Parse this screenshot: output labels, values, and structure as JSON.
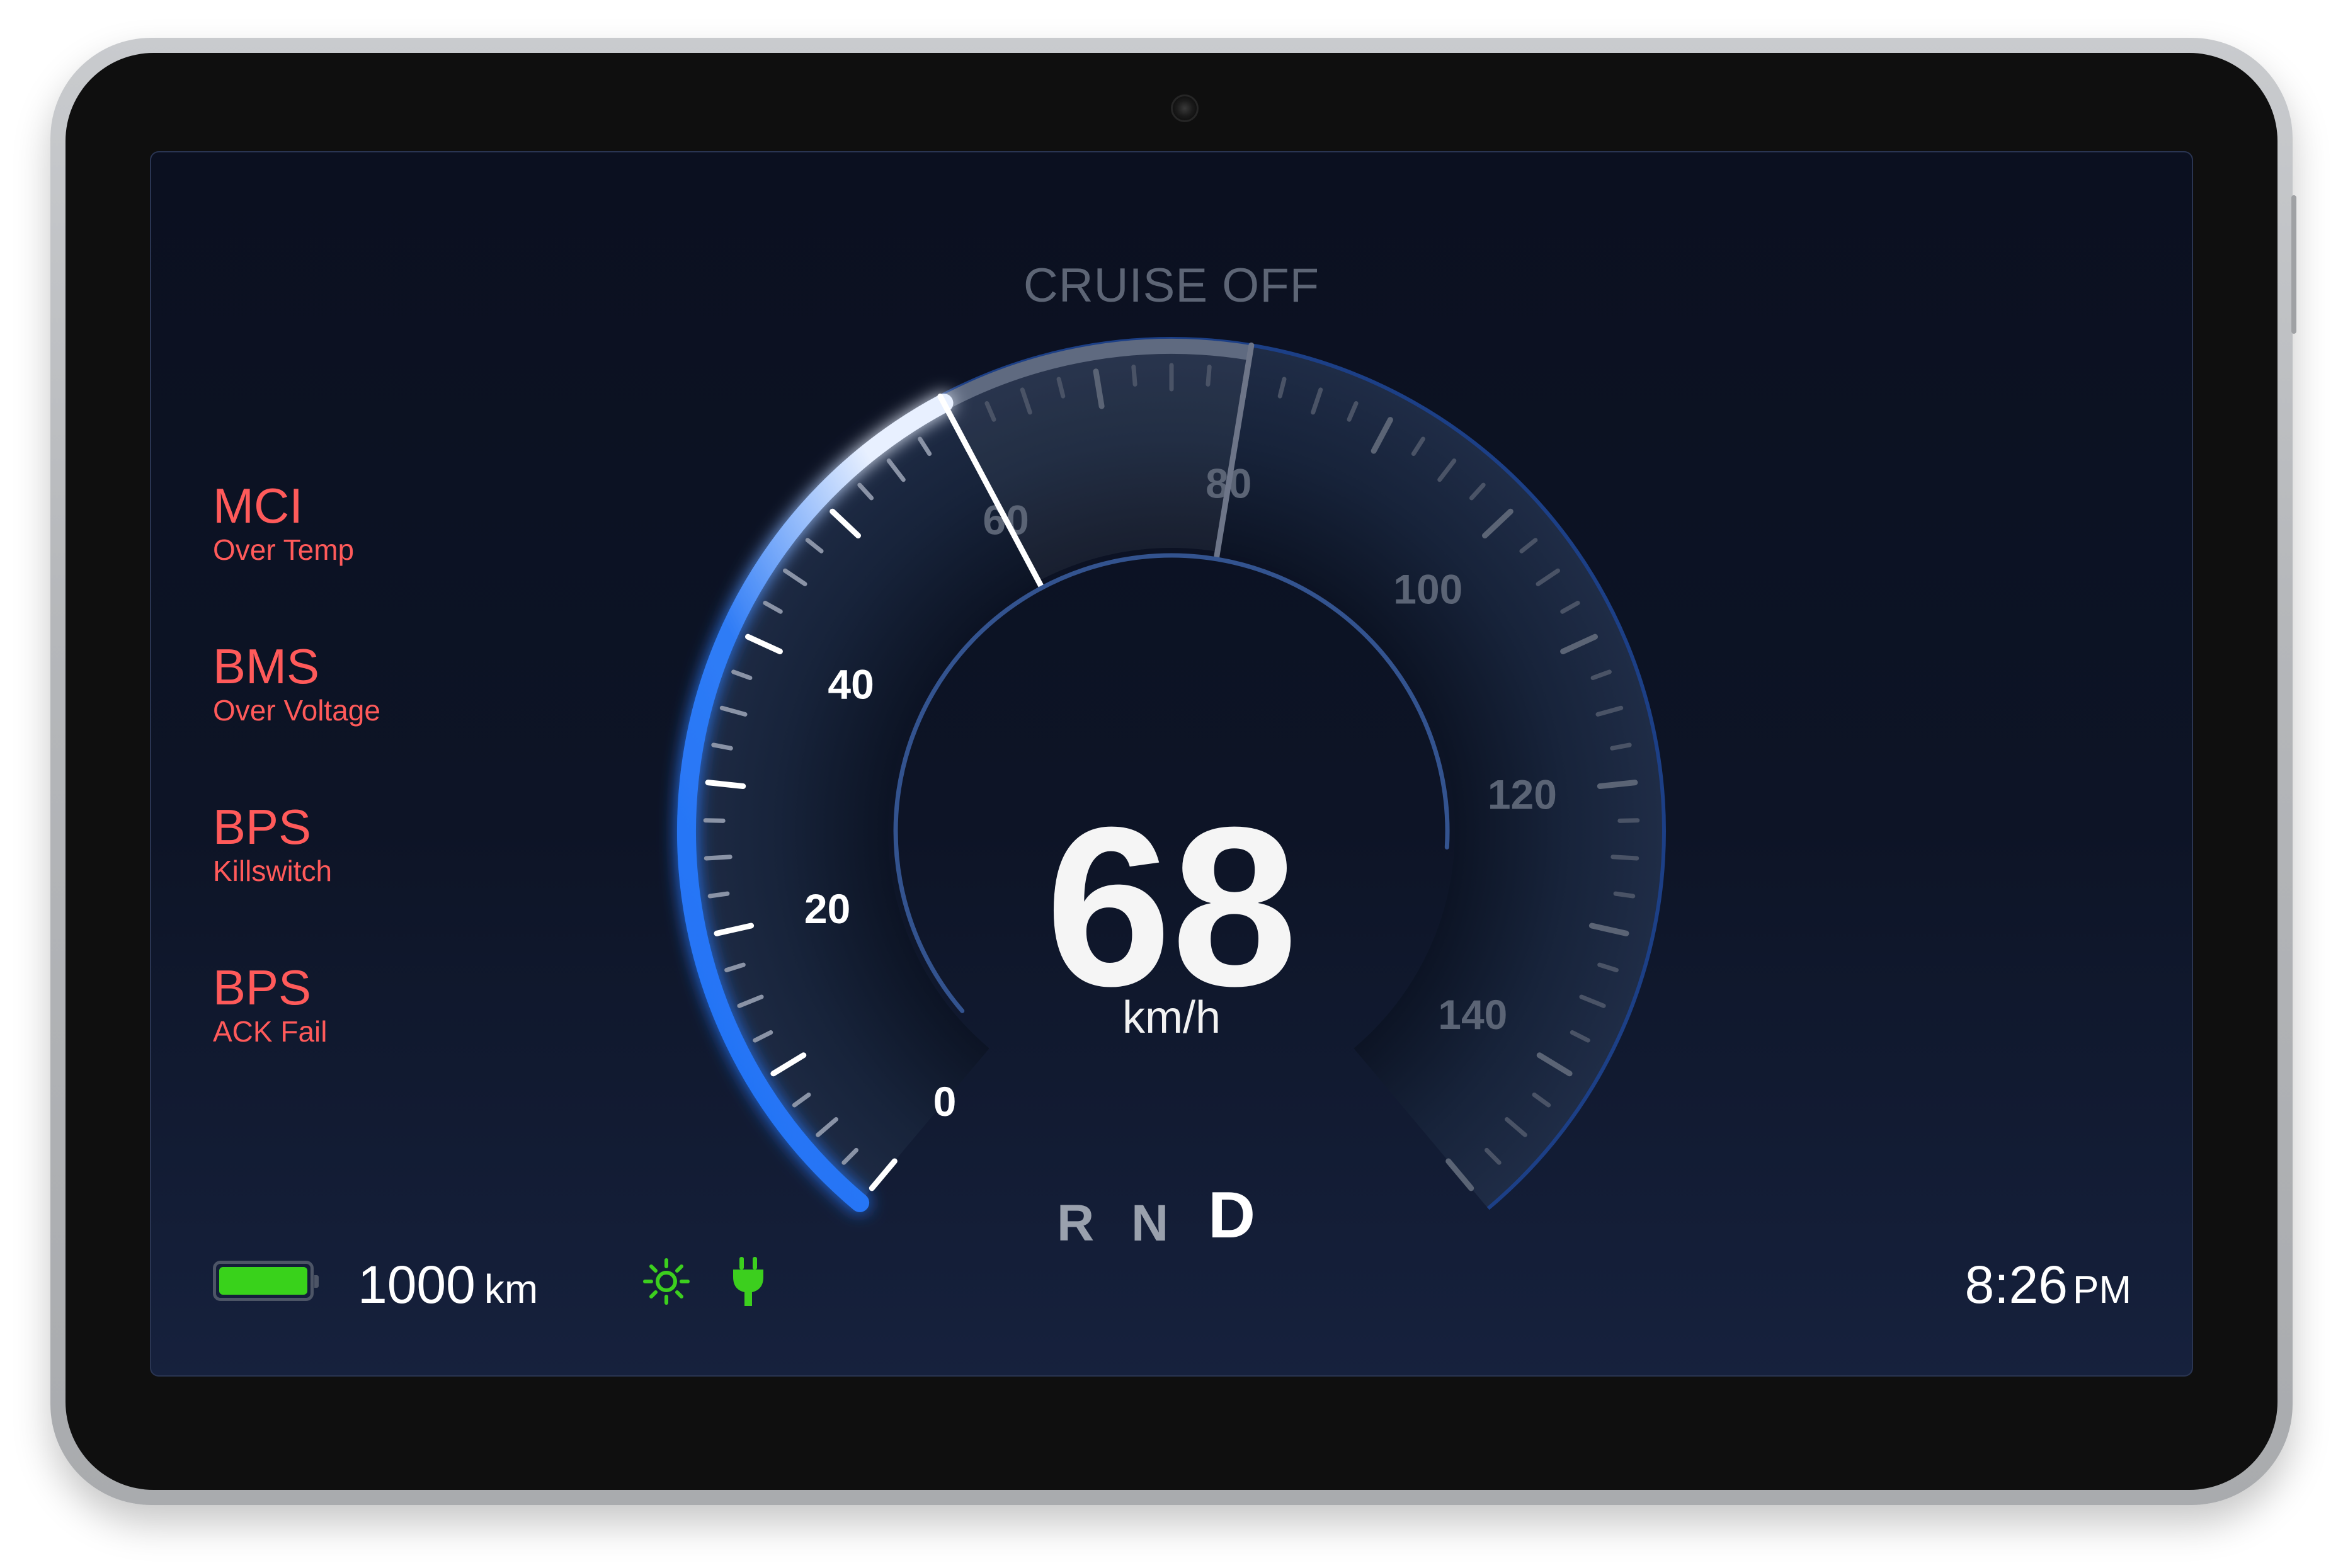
{
  "cruise_status": "CRUISE OFF",
  "faults": [
    {
      "code": "MCI",
      "description": "Over Temp"
    },
    {
      "code": "BMS",
      "description": "Over Voltage"
    },
    {
      "code": "BPS",
      "description": "Killswitch"
    },
    {
      "code": "BPS",
      "description": "ACK Fail"
    }
  ],
  "speedometer": {
    "speed": "68",
    "speed_value": 68,
    "unit": "km/h",
    "scale_min": 0,
    "scale_max": 150,
    "tick_labels": [
      "0",
      "20",
      "40",
      "60",
      "80",
      "100",
      "120",
      "140"
    ],
    "highlight_range": [
      60,
      80
    ],
    "colors": {
      "accent": "#1e6ff5",
      "label_active": "#ffffff",
      "label_inactive": "#5b6475"
    }
  },
  "gears": [
    {
      "label": "R",
      "active": false
    },
    {
      "label": "N",
      "active": false
    },
    {
      "label": "D",
      "active": true
    }
  ],
  "status_bar": {
    "battery_level": 1.0,
    "battery_color": "#39d21b",
    "range_value": "1000",
    "range_unit": "km",
    "headlight_icon": "headlight-sun-icon",
    "charging_icon": "plug-icon",
    "indicator_color": "#3ccf1e",
    "time": "8:26",
    "ampm": "PM"
  }
}
